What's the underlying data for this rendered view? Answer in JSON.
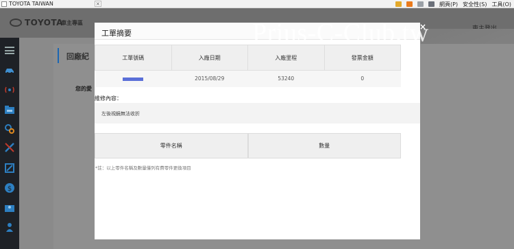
{
  "browser": {
    "tab_title": "TOYOTA TAIWAN",
    "tab_close": "×",
    "menus": [
      "網頁(P)",
      "安全性(S)",
      "工具(O)"
    ]
  },
  "site": {
    "brand": "TOYOTA",
    "owner_area": "車主專區",
    "logout": "車主登出",
    "page_title": "回廠紀",
    "section_label": "您的愛"
  },
  "modal": {
    "title": "工單摘要",
    "close_glyph": "×",
    "table": {
      "headers": [
        "工單號碼",
        "入廠日期",
        "入廠里程",
        "發票金額"
      ],
      "row": {
        "order_no": "",
        "date": "2015/08/29",
        "mileage": "53240",
        "amount": "0"
      }
    },
    "repair_label": "維修內容：",
    "repair_text": "左後視鏡無法收折",
    "parts_headers": [
      "零件名稱",
      "數量"
    ],
    "note": "*註：以上零件名稱及數量僅列有費零件更換項目"
  },
  "watermark": "Prius-C-Club.tw",
  "colors": {
    "accent": "#1a66b3",
    "masked": "#5a6fd8",
    "sidebar": "#1e2126"
  },
  "sidebar_icons": [
    "menu-icon",
    "car-icon",
    "signal-icon",
    "folder-car-icon",
    "gears-icon",
    "tools-icon",
    "ruler-icon",
    "dollar-icon",
    "book-user-icon",
    "person-icon"
  ]
}
